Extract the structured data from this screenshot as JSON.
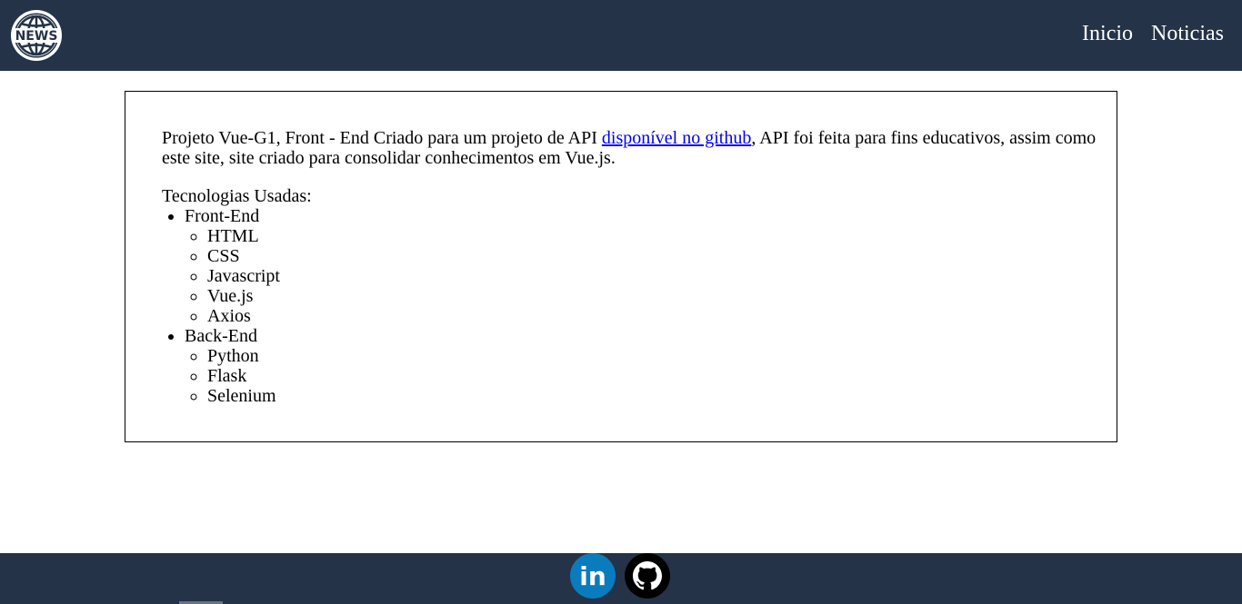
{
  "header": {
    "logo_text": "NEWS",
    "nav": [
      {
        "label": "Inicio"
      },
      {
        "label": "Noticias"
      }
    ]
  },
  "main": {
    "intro_before_link": "Projeto Vue-G1, Front - End Criado para um projeto de API ",
    "intro_link": "disponível no github",
    "intro_after_link": ", API foi feita para fins educativos, assim como este site, site criado para consolidar conhecimentos em Vue.js.",
    "tech_title": "Tecnologias Usadas:",
    "tech_groups": [
      {
        "label": "Front-End",
        "items": [
          "HTML",
          "CSS",
          "Javascript",
          "Vue.js",
          "Axios"
        ]
      },
      {
        "label": "Back-End",
        "items": [
          "Python",
          "Flask",
          "Selenium"
        ]
      }
    ]
  },
  "footer": {
    "icons": [
      "linkedin-icon",
      "github-icon"
    ],
    "linkedin_text": "in"
  },
  "colors": {
    "header_bg": "#243347",
    "footer_bg": "#243347",
    "link": "#0000ee",
    "linkedin_blue": "#0a7cbe"
  }
}
